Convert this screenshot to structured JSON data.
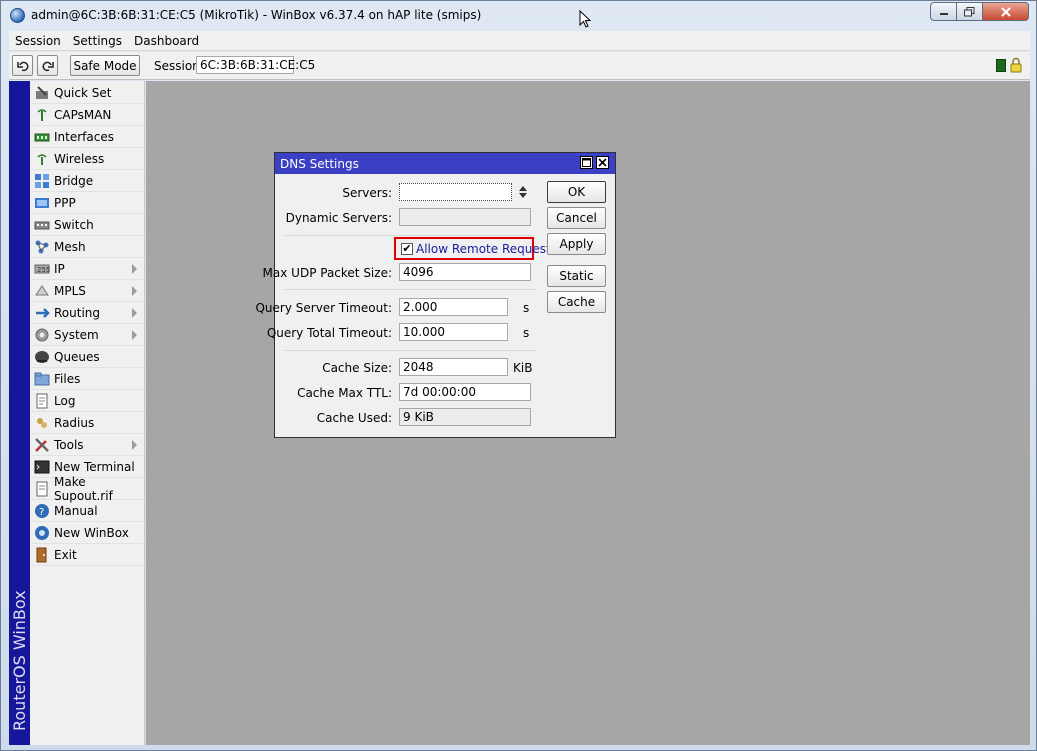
{
  "window": {
    "title": "admin@6C:3B:6B:31:CE:C5 (MikroTik) - WinBox v6.37.4 on hAP lite (smips)"
  },
  "menubar": {
    "items": [
      "Session",
      "Settings",
      "Dashboard"
    ]
  },
  "toolbar": {
    "safe_mode_label": "Safe Mode",
    "session_label": "Session:",
    "session_value": "6C:3B:6B:31:CE:C5"
  },
  "brand": {
    "vertical_text": "RouterOS WinBox"
  },
  "sidebar": {
    "items": [
      {
        "label": "Quick Set",
        "icon": "quick-set-icon",
        "submenu": false
      },
      {
        "label": "CAPsMAN",
        "icon": "capsman-icon",
        "submenu": false
      },
      {
        "label": "Interfaces",
        "icon": "interfaces-icon",
        "submenu": false
      },
      {
        "label": "Wireless",
        "icon": "wireless-icon",
        "submenu": false
      },
      {
        "label": "Bridge",
        "icon": "bridge-icon",
        "submenu": false
      },
      {
        "label": "PPP",
        "icon": "ppp-icon",
        "submenu": false
      },
      {
        "label": "Switch",
        "icon": "switch-icon",
        "submenu": false
      },
      {
        "label": "Mesh",
        "icon": "mesh-icon",
        "submenu": false
      },
      {
        "label": "IP",
        "icon": "ip-icon",
        "submenu": true
      },
      {
        "label": "MPLS",
        "icon": "mpls-icon",
        "submenu": true
      },
      {
        "label": "Routing",
        "icon": "routing-icon",
        "submenu": true
      },
      {
        "label": "System",
        "icon": "system-icon",
        "submenu": true
      },
      {
        "label": "Queues",
        "icon": "queues-icon",
        "submenu": false
      },
      {
        "label": "Files",
        "icon": "files-icon",
        "submenu": false
      },
      {
        "label": "Log",
        "icon": "log-icon",
        "submenu": false
      },
      {
        "label": "Radius",
        "icon": "radius-icon",
        "submenu": false
      },
      {
        "label": "Tools",
        "icon": "tools-icon",
        "submenu": true
      },
      {
        "label": "New Terminal",
        "icon": "terminal-icon",
        "submenu": false
      },
      {
        "label": "Make Supout.rif",
        "icon": "supout-icon",
        "submenu": false
      },
      {
        "label": "Manual",
        "icon": "manual-icon",
        "submenu": false
      },
      {
        "label": "New WinBox",
        "icon": "new-winbox-icon",
        "submenu": false
      },
      {
        "label": "Exit",
        "icon": "exit-icon",
        "submenu": false
      }
    ]
  },
  "dns_dialog": {
    "title": "DNS Settings",
    "fields": {
      "servers": {
        "label": "Servers:",
        "value": ""
      },
      "dynamic_servers": {
        "label": "Dynamic Servers:",
        "value": ""
      },
      "allow_remote": {
        "label": "Allow Remote Requests",
        "checked": true
      },
      "max_udp": {
        "label": "Max UDP Packet Size:",
        "value": "4096"
      },
      "query_server_timeout": {
        "label": "Query Server Timeout:",
        "value": "2.000",
        "unit": "s"
      },
      "query_total_timeout": {
        "label": "Query Total Timeout:",
        "value": "10.000",
        "unit": "s"
      },
      "cache_size": {
        "label": "Cache Size:",
        "value": "2048",
        "unit": "KiB"
      },
      "cache_max_ttl": {
        "label": "Cache Max TTL:",
        "value": "7d 00:00:00"
      },
      "cache_used": {
        "label": "Cache Used:",
        "value": "9 KiB"
      }
    },
    "buttons": {
      "ok": "OK",
      "cancel": "Cancel",
      "apply": "Apply",
      "static": "Static",
      "cache": "Cache"
    }
  },
  "colors": {
    "brand_strip": "#16169a",
    "dialog_title": "#3a3fc4",
    "workspace": "#a6a6a6",
    "highlight": "#e00000"
  }
}
